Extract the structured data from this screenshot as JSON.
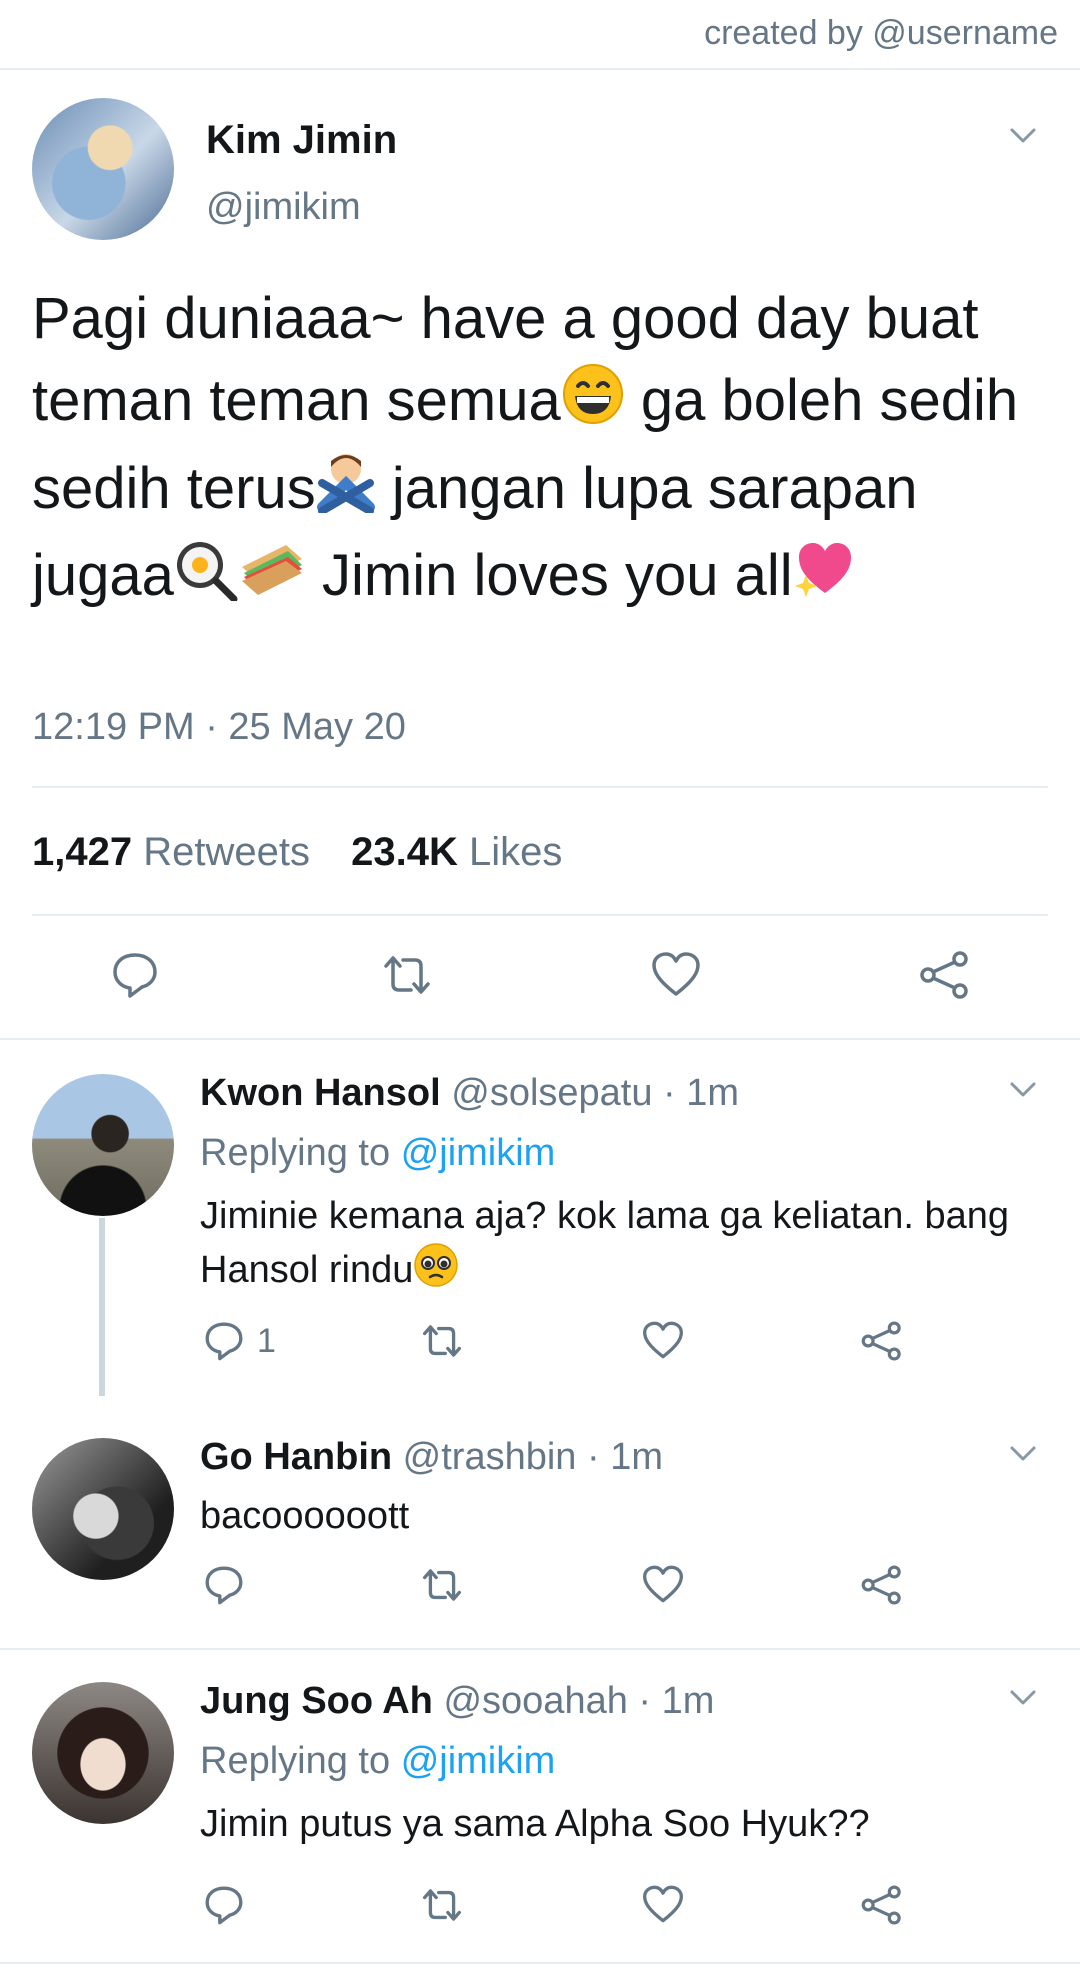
{
  "credit": "created by @username",
  "main_tweet": {
    "name": "Kim Jimin",
    "handle": "@jimikim",
    "text_parts": {
      "p1": "Pagi duniaaa~ have a good day buat teman teman semua",
      "p2": " ga boleh sedih sedih terus",
      "p3": " jangan lupa sarapan jugaa",
      "p4": " Jimin loves you all"
    },
    "timestamp": "12:19 PM · 25 May 20",
    "retweets_count": "1,427",
    "retweets_label": "Retweets",
    "likes_count": "23.4K",
    "likes_label": "Likes"
  },
  "replies": [
    {
      "name": "Kwon Hansol",
      "handle_time": "@solsepatu · 1m",
      "replying_label": "Replying to",
      "replying_to": "@jimikim",
      "text": "Jiminie kemana aja? kok lama ga keliatan. bang Hansol rindu",
      "reply_count": "1"
    },
    {
      "name": "Go Hanbin",
      "handle_time": "@trashbin · 1m",
      "text": "bacoooooott"
    },
    {
      "name": "Jung Soo Ah",
      "handle_time": "@sooahah · 1m",
      "replying_label": "Replying to",
      "replying_to": "@jimikim",
      "text": "Jimin putus ya sama Alpha Soo Hyuk??"
    }
  ],
  "colors": {
    "link": "#1da1f2",
    "secondary": "#657786",
    "border": "#e6ecf0"
  },
  "icons": [
    "chevron-down-icon",
    "reply-icon",
    "retweet-icon",
    "like-icon",
    "share-icon"
  ]
}
